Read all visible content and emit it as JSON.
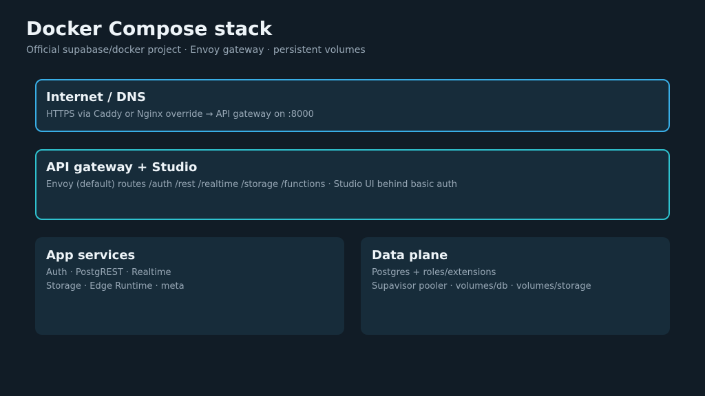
{
  "header": {
    "title": "Docker Compose stack",
    "subtitle": "Official supabase/docker project · Envoy gateway · persistent volumes"
  },
  "layers": {
    "internet": {
      "title": "Internet / DNS",
      "line1": "HTTPS via Caddy or Nginx override → API gateway on :8000"
    },
    "gateway": {
      "title": "API gateway + Studio",
      "line1": "Envoy (default) routes /auth /rest /realtime /storage /functions · Studio UI behind basic auth"
    },
    "app_services": {
      "title": "App services",
      "line1": "Auth · PostgREST · Realtime",
      "line2": "Storage · Edge Runtime · meta"
    },
    "data_plane": {
      "title": "Data plane",
      "line1": "Postgres + roles/extensions",
      "line2": "Supavisor pooler · volumes/db · volumes/storage"
    }
  },
  "colors": {
    "background": "#111c26",
    "card": "#172c3a",
    "internet_border": "#39aee6",
    "gateway_border": "#2fc2cf",
    "title_text": "#eef4f8",
    "body_text": "#98a8b6"
  }
}
